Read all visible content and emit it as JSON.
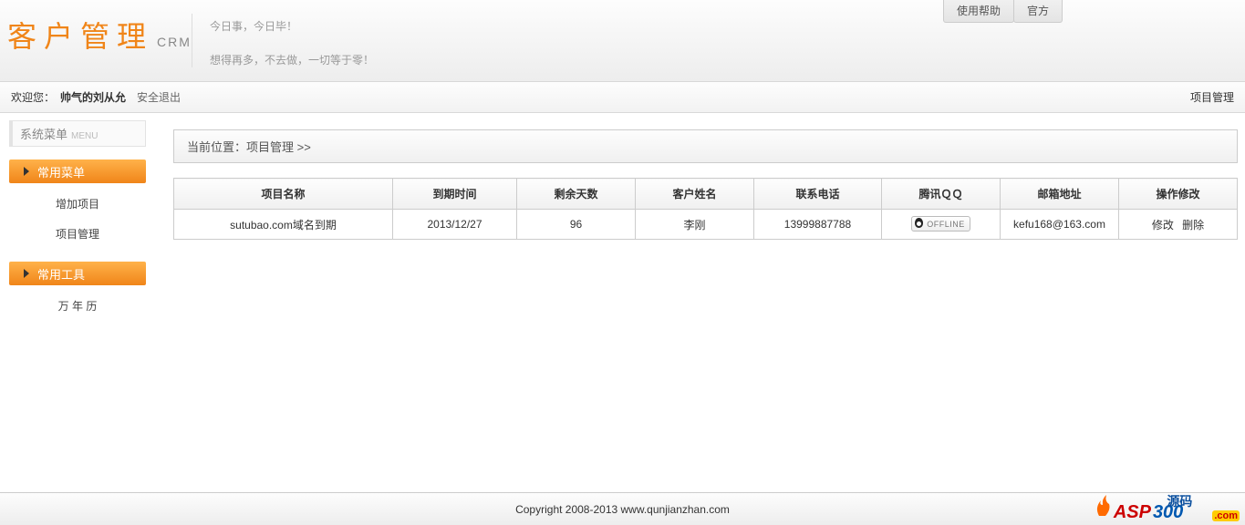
{
  "top_links": {
    "help": "使用帮助",
    "official": "官方"
  },
  "logo": {
    "main": "客户管理",
    "sub": "CRM"
  },
  "slogan": {
    "line1": "今日事，今日毕！",
    "line2": "想得再多，不去做，一切等于零！"
  },
  "welcome": {
    "label": "欢迎您：",
    "user": "帅气的刘从允",
    "logout": "安全退出",
    "right_link": "项目管理"
  },
  "sidebar": {
    "title_cn": "系统菜单",
    "title_en": "MENU",
    "cat1": "常用菜单",
    "items1": [
      "增加项目",
      "项目管理"
    ],
    "cat2": "常用工具",
    "items2": [
      "万 年 历"
    ]
  },
  "breadcrumb": "当前位置：项目管理 >>",
  "table": {
    "headers": [
      "项目名称",
      "到期时间",
      "剩余天数",
      "客户姓名",
      "联系电话",
      "腾讯ＱＱ",
      "邮箱地址",
      "操作修改"
    ],
    "row": {
      "name": "sutubao.com域名到期",
      "expire": "2013/12/27",
      "days": "96",
      "customer": "李刚",
      "phone": "13999887788",
      "qq_status": "OFFLINE",
      "email": "kefu168@163.com",
      "op_edit": "修改",
      "op_delete": "删除"
    }
  },
  "footer": "Copyright 2008-2013 www.qunjianzhan.com",
  "watermark": {
    "asp": "ASP",
    "num": "300",
    "dot": ".com",
    "cn": "源码"
  }
}
